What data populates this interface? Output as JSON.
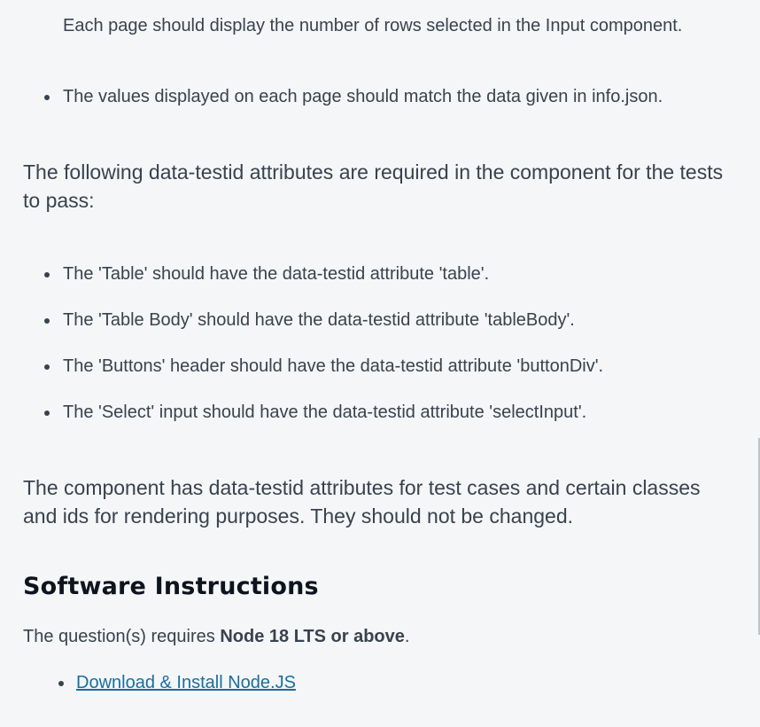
{
  "continuation_text": "Each page should display the number of rows selected in the Input component.",
  "bullets_top": [
    "The values displayed on each page should match the data given in info.json."
  ],
  "paragraph_testid": "The following data-testid attributes are required in the component for the tests to pass:",
  "bullets_testid": [
    "The 'Table' should have the data-testid attribute 'table'.",
    "The 'Table Body' should have the data-testid attribute 'tableBody'.",
    "The 'Buttons' header should have the data-testid attribute 'buttonDiv'.",
    "The 'Select' input should have the data-testid attribute 'selectInput'."
  ],
  "paragraph_component": "The component has data-testid attributes for test cases and certain classes and ids for rendering purposes. They should not be changed.",
  "software": {
    "heading": "Software Instructions",
    "requirement_prefix": "The question(s) requires ",
    "requirement_bold": "Node 18 LTS or above",
    "requirement_suffix": ".",
    "link_text": "Download & Install Node.JS"
  }
}
